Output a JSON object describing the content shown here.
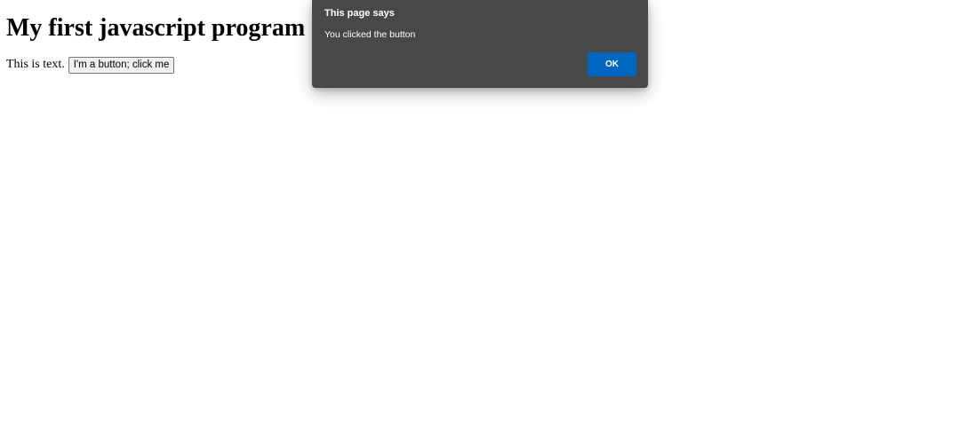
{
  "page": {
    "heading": "My first javascript program",
    "body_text": "This is text.",
    "button_label": "I'm a button; click me"
  },
  "dialog": {
    "title": "This page says",
    "message": "You clicked the button",
    "ok_label": "OK"
  },
  "colors": {
    "dialog_background": "#484848",
    "ok_button": "#0067c0",
    "page_background": "#ffffff"
  }
}
